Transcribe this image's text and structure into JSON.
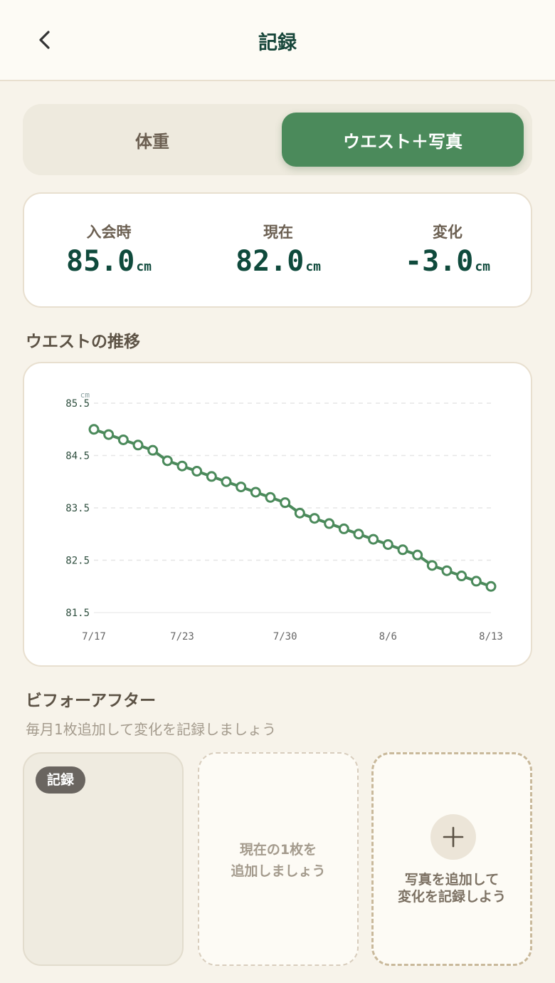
{
  "header": {
    "title": "記録",
    "back_icon": "chevron-left-icon"
  },
  "tabs": [
    {
      "label": "体重",
      "active": false
    },
    {
      "label": "ウエスト＋写真",
      "active": true
    }
  ],
  "stats": [
    {
      "label": "入会時",
      "value": "85.0",
      "unit": "cm"
    },
    {
      "label": "現在",
      "value": "82.0",
      "unit": "cm"
    },
    {
      "label": "変化",
      "value": "-3.0",
      "unit": "cm"
    }
  ],
  "waist_section": {
    "title": "ウエストの推移"
  },
  "chart_data": {
    "type": "line",
    "ylabel": "cm",
    "ylim": [
      81.5,
      85.5
    ],
    "y_ticks": [
      "85.5",
      "84.5",
      "83.5",
      "82.5",
      "81.5"
    ],
    "x_ticks": [
      "7/17",
      "7/23",
      "7/30",
      "8/6",
      "8/13"
    ],
    "grid": true,
    "color": "#4b8a5b",
    "series": [
      {
        "x": [
          "7/17",
          "7/18",
          "7/19",
          "7/20",
          "7/21",
          "7/22",
          "7/23",
          "7/24",
          "7/25",
          "7/26",
          "7/27",
          "7/28",
          "7/29",
          "7/30",
          "7/31",
          "8/1",
          "8/2",
          "8/3",
          "8/4",
          "8/5",
          "8/6",
          "8/7",
          "8/8",
          "8/9",
          "8/10",
          "8/11",
          "8/12",
          "8/13"
        ],
        "values": [
          85.0,
          84.9,
          84.8,
          84.7,
          84.6,
          84.4,
          84.3,
          84.2,
          84.1,
          84.0,
          83.9,
          83.8,
          83.7,
          83.6,
          83.4,
          83.3,
          83.2,
          83.1,
          83.0,
          82.9,
          82.8,
          82.7,
          82.6,
          82.4,
          82.3,
          82.2,
          82.1,
          82.0
        ]
      }
    ]
  },
  "before_after": {
    "title": "ビフォーアフター",
    "subtitle": "毎月1枚追加して変化を記録しましょう",
    "photo1_badge": "記録",
    "photo2_line1": "現在の1枚を",
    "photo2_line2": "追加しましょう",
    "photo3_icon": "plus-icon",
    "photo3_line1": "写真を追加して",
    "photo3_line2": "変化を記録しよう"
  }
}
